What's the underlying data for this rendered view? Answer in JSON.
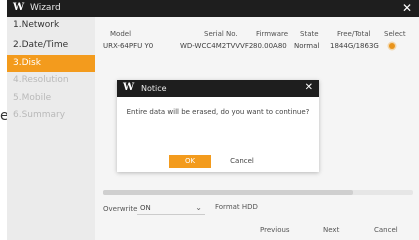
{
  "left_glyph": "e",
  "window": {
    "logo": "W",
    "title": "Wizard",
    "close_icon": "✕"
  },
  "sidebar": {
    "items": [
      {
        "label": "1.Network"
      },
      {
        "label": "2.Date/Time"
      },
      {
        "label": "3.Disk"
      },
      {
        "label": "4.Resolution"
      },
      {
        "label": "5.Mobile"
      },
      {
        "label": "6.Summary"
      }
    ]
  },
  "table": {
    "headers": [
      "Model",
      "Serial No.",
      "Firmware",
      "State",
      "Free/Total",
      "Select"
    ],
    "rows": [
      [
        "URX-64PFU Y0",
        "WD-WCC4M2TVVVF2",
        "80.00A80",
        "Normal",
        "1844G/1863G"
      ]
    ]
  },
  "overwrite": {
    "label": "Overwrite",
    "value": "ON",
    "format_label": "Format HDD"
  },
  "footer": {
    "previous": "Previous",
    "next": "Next",
    "cancel": "Cancel"
  },
  "modal": {
    "logo": "W",
    "title": "Notice",
    "close_icon": "✕",
    "message": "Entire data will be erased, do you want to continue?",
    "ok": "OK",
    "cancel": "Cancel"
  },
  "colors": {
    "accent": "#f39b1d",
    "titlebar": "#1e1e1e",
    "sidebar": "#ebebeb"
  }
}
